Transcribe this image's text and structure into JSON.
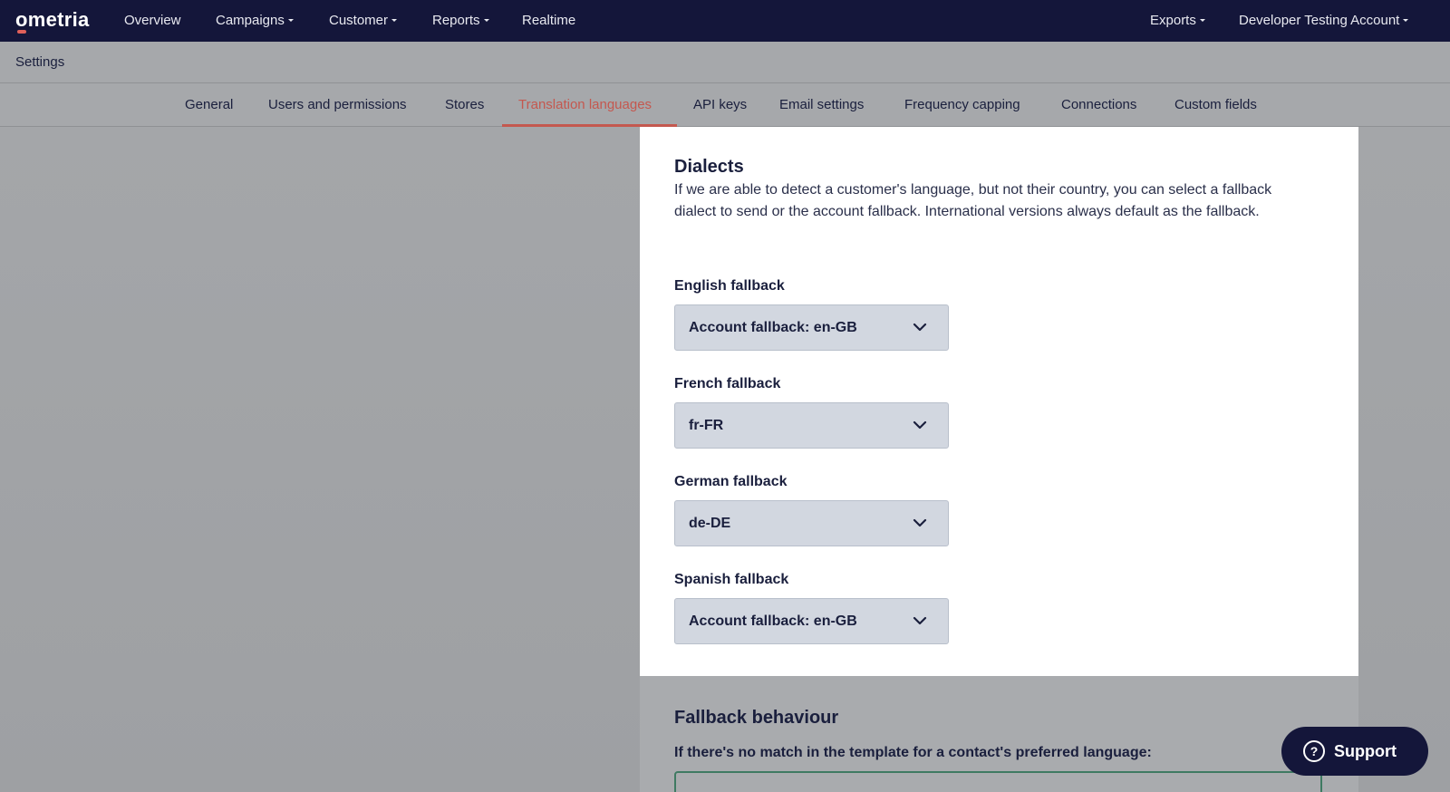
{
  "topnav": {
    "logo": "ometria",
    "items": [
      "Overview",
      "Campaigns",
      "Customer",
      "Reports",
      "Realtime"
    ],
    "exports": "Exports",
    "account": "Developer Testing Account"
  },
  "settings": {
    "title": "Settings"
  },
  "tabs": [
    "General",
    "Users and permissions",
    "Stores",
    "Translation languages",
    "API keys",
    "Email settings",
    "Frequency capping",
    "Connections",
    "Custom fields"
  ],
  "active_tab": "Translation languages",
  "dialects": {
    "title": "Dialects",
    "description": "If we are able to detect a customer's language, but not their country, you can select a fallback dialect to send or the account fallback. International versions always default as the fallback.",
    "fields": [
      {
        "label": "English fallback",
        "value": "Account fallback: en-GB"
      },
      {
        "label": "French fallback",
        "value": "fr-FR"
      },
      {
        "label": "German fallback",
        "value": "de-DE"
      },
      {
        "label": "Spanish fallback",
        "value": "Account fallback: en-GB"
      }
    ]
  },
  "fallback_behaviour": {
    "title": "Fallback behaviour",
    "subtitle": "If there's no match in the template for a contact's preferred language:"
  },
  "support": {
    "label": "Support",
    "icon": "question-icon"
  },
  "colors": {
    "nav_bg": "#14163a",
    "accent": "#c4584f",
    "select_bg": "#d2d7e0"
  }
}
